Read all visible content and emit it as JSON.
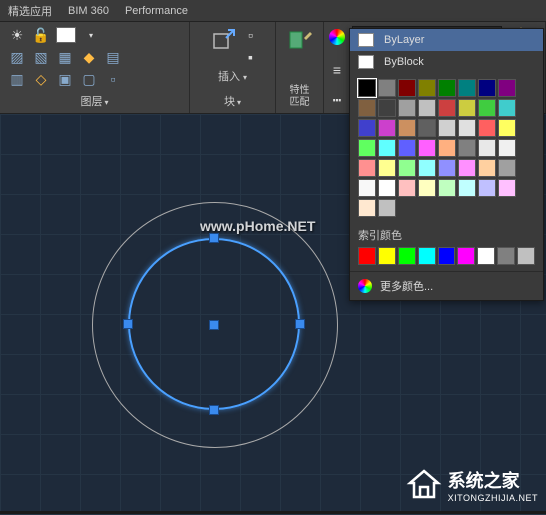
{
  "tabs": {
    "t1": "精选应用",
    "t2": "BIM 360",
    "t3": "Performance"
  },
  "panels": {
    "layers_label": "图层",
    "blocks_label": "块",
    "insert_label": "插入",
    "props_label": "特性\n匹配",
    "color_dd_text": "ByLayer"
  },
  "dropdown": {
    "bylayer": "ByLayer",
    "byblock": "ByBlock",
    "index_label": "索引颜色",
    "more": "更多颜色..."
  },
  "swatches": [
    "#000000",
    "#808080",
    "#800000",
    "#808000",
    "#008000",
    "#008080",
    "#000080",
    "#800080",
    "#806040",
    "#404040",
    "#a0a0a0",
    "#c0c0c0",
    "#cc4040",
    "#cccc40",
    "#40cc40",
    "#40cccc",
    "#4040cc",
    "#cc40cc",
    "#cc9060",
    "#606060",
    "#d0d0d0",
    "#e0e0e0",
    "#ff6060",
    "#ffff60",
    "#60ff60",
    "#60ffff",
    "#6060ff",
    "#ff60ff",
    "#ffb080",
    "#808080",
    "#e8e8e8",
    "#f0f0f0",
    "#ff9090",
    "#ffff90",
    "#90ff90",
    "#90ffff",
    "#9090ff",
    "#ff90ff",
    "#ffd0a0",
    "#a0a0a0",
    "#f8f8f8",
    "#ffffff",
    "#ffc0c0",
    "#ffffc0",
    "#c0ffc0",
    "#c0ffff",
    "#c0c0ff",
    "#ffc0ff",
    "#ffe8d0",
    "#c0c0c0"
  ],
  "index_colors": [
    "#ff0000",
    "#ffff00",
    "#00ff00",
    "#00ffff",
    "#0000ff",
    "#ff00ff",
    "#ffffff",
    "#808080",
    "#c0c0c0"
  ],
  "watermarks": {
    "w1": "www.pHome.NET",
    "w2_cn": "系统之家",
    "w2_en": "XITONGZHIJIA.NET"
  }
}
